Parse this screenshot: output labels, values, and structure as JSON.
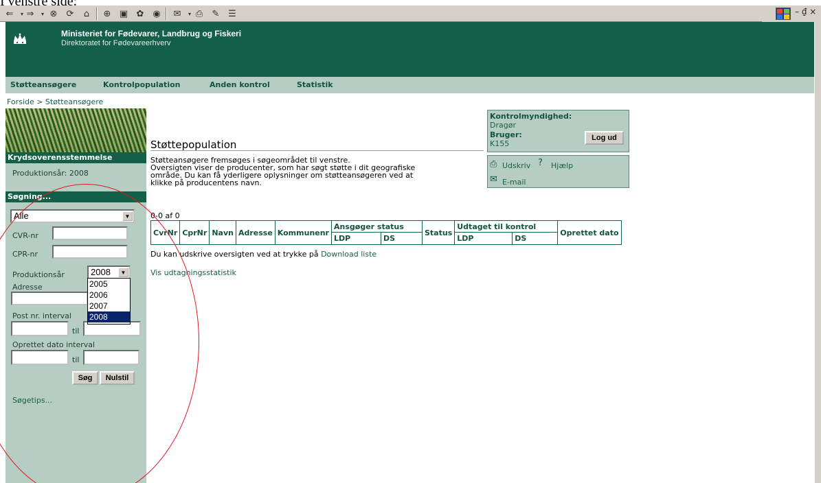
{
  "caption": "I venstre side:",
  "toolbar": {
    "icons": [
      "back-icon",
      "forward-icon",
      "stop-icon",
      "refresh-icon",
      "home-icon",
      "search-icon",
      "favorites-icon",
      "history-icon",
      "media-icon",
      "mail-icon",
      "print-icon",
      "edit-icon",
      "discuss-icon"
    ],
    "window_controls": "– ₫ ×"
  },
  "header": {
    "ministry": "Ministeriet for Fødevarer, Landbrug og Fiskeri",
    "directorate": "Direktoratet for Fødevareerhverv"
  },
  "nav": {
    "items": [
      "Støtteansøgere",
      "Kontrolpopulation",
      "Anden kontrol",
      "Statistik"
    ]
  },
  "breadcrumb": "Forside > Støtteansøgere",
  "sidebar": {
    "section_title": "Krydsoverensstemmelse",
    "production_year": "Produktionsår: 2008",
    "search_title": "Søgning...",
    "filter_select": "Alle",
    "cvr_label": "CVR-nr",
    "cpr_label": "CPR-nr",
    "prod_year_label": "Produktionsår",
    "prod_year_value": "2008",
    "year_options": [
      "2005",
      "2006",
      "2007",
      "2008"
    ],
    "address_label": "Adresse",
    "postal_label": "Post nr. interval",
    "to_label": "til",
    "created_label": "Oprettet dato interval",
    "search_button": "Søg",
    "reset_button": "Nulstil",
    "tips": "Søgetips..."
  },
  "main": {
    "title": "Støttepopulation",
    "intro": [
      "Støtteansøgere fremsøges i søgeområdet til venstre.",
      "Oversigten viser de producenter, som har søgt støtte i dit geografiske",
      "område. Du kan få yderligere oplysninger om støtteansøgeren ved at",
      "klikke på producentens navn."
    ],
    "count": "0-0 af 0",
    "table_headers": [
      "CvrNr",
      "CprNr",
      "Navn",
      "Adresse",
      "Kommunenr",
      "Ansgøger status",
      "Status",
      "Udtaget til kontrol",
      "Oprettet dato"
    ],
    "sub_headers": [
      "LDP",
      "DS",
      "LDP",
      "DS"
    ],
    "download_text": "Du kan udskrive oversigten ved at trykke på",
    "download_link": "Download liste",
    "stats_link": "Vis udtagningsstatistik"
  },
  "authority": {
    "label": "Kontrolmyndighed:",
    "value": "Dragør",
    "user_label": "Bruger:",
    "user_value": "K155",
    "logout": "Log ud"
  },
  "tools": {
    "print": "Udskriv",
    "help": "Hjælp",
    "email": "E-mail"
  },
  "colors": {
    "header": "#135f48",
    "nav": "#b6cdc4",
    "link": "#1b5e46",
    "annotation": "#e3161c"
  }
}
